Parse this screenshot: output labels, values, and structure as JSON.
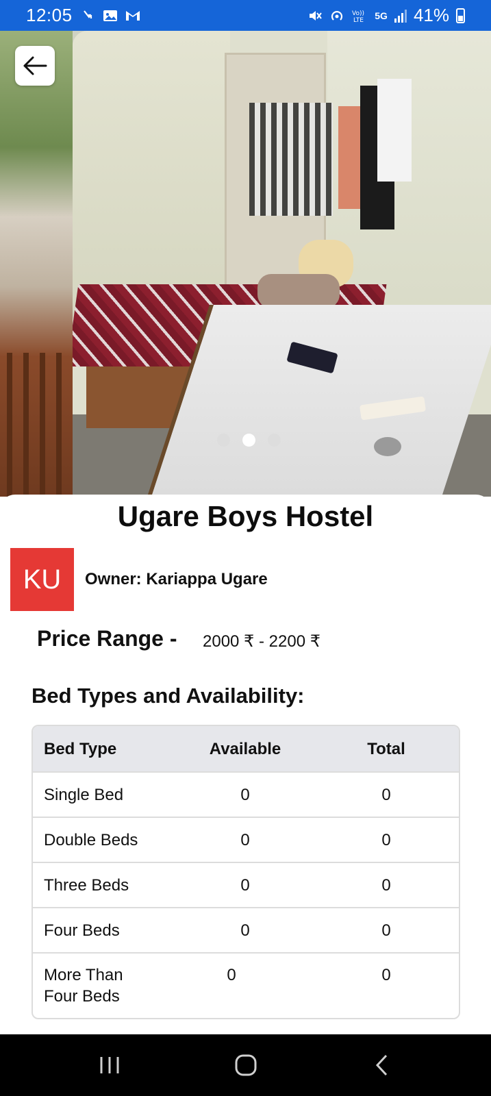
{
  "status_bar": {
    "time": "12:05",
    "battery": "41%",
    "network": "5G",
    "left_icons": [
      "missed-call-icon",
      "gallery-icon",
      "gmail-icon"
    ],
    "right_icons": [
      "mute-icon",
      "hotspot-icon",
      "volte-icon",
      "5g-icon",
      "signal-icon",
      "battery-icon"
    ]
  },
  "carousel": {
    "image_count": 3,
    "active_index": 1
  },
  "hostel": {
    "title": "Ugare Boys Hostel",
    "avatar_initials": "KU",
    "avatar_color": "#e53935",
    "owner_text": "Owner: Kariappa Ugare",
    "price_label": "Price Range -",
    "price_value": "2000 ₹ - 2200 ₹"
  },
  "availability": {
    "heading": "Bed Types and Availability:",
    "columns": [
      "Bed Type",
      "Available",
      "Total"
    ],
    "rows": [
      {
        "type": "Single Bed",
        "available": "0",
        "total": "0"
      },
      {
        "type": "Double Beds",
        "available": "0",
        "total": "0"
      },
      {
        "type": "Three Beds",
        "available": "0",
        "total": "0"
      },
      {
        "type": "Four Beds",
        "available": "0",
        "total": "0"
      },
      {
        "type": "More Than Four Beds",
        "available": "0",
        "total": "0"
      }
    ]
  },
  "colors": {
    "status_bar": "#1565d8",
    "header_row": "#e6e7eb",
    "nav_bar": "#000000"
  },
  "nav": [
    "recent-apps-icon",
    "home-icon",
    "back-nav-icon"
  ]
}
